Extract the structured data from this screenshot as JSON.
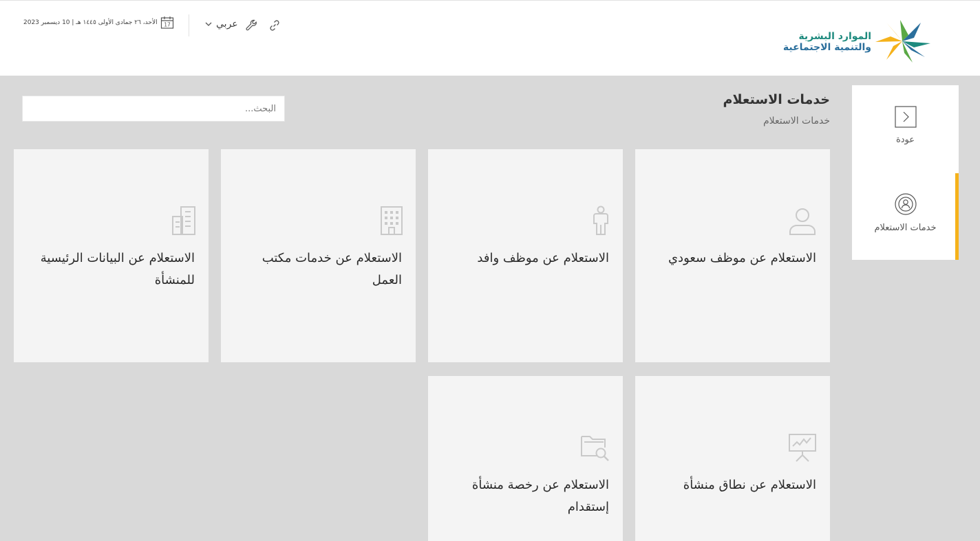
{
  "header": {
    "logo": {
      "line1": "الموارد البشرية",
      "line2": "والتنمية الاجتماعية",
      "colors": {
        "teal": "#1e8a7e",
        "blue": "#2b6f9c",
        "yellow": "#f5b21b",
        "green": "#5aa845"
      }
    },
    "date_text": "الأحد، ٢٦ جمادى الأولى ١٤٤٥ هـ | 10 ديسمبر 2023",
    "calendar_day": "17",
    "language_label": "عربي",
    "icons": {
      "calendar": "calendar-icon",
      "chevron": "chevron-down-icon",
      "tools": "wrench-icon",
      "link": "link-icon"
    }
  },
  "sidebar": {
    "items": [
      {
        "label": "عودة",
        "icon": "back-arrow-icon"
      },
      {
        "label": "خدمات الاستعلام",
        "icon": "inquiry-services-icon"
      }
    ],
    "active_color": "#f5b21b"
  },
  "main": {
    "title": "خدمات الاستعلام",
    "breadcrumb": "خدمات الاستعلام",
    "search_placeholder": "البحث...",
    "cards": [
      {
        "title": "الاستعلام عن موظف سعودي",
        "icon": "person-icon"
      },
      {
        "title": "الاستعلام عن موظف وافد",
        "icon": "standing-person-icon"
      },
      {
        "title": "الاستعلام عن خدمات مكتب العمل",
        "icon": "office-building-icon"
      },
      {
        "title": "الاستعلام عن البيانات الرئيسية للمنشأة",
        "icon": "buildings-icon"
      },
      {
        "title": "الاستعلام عن نطاق منشأة",
        "icon": "presentation-chart-icon"
      },
      {
        "title": "الاستعلام عن رخصة منشأة إستقدام",
        "icon": "folder-search-icon"
      }
    ]
  }
}
